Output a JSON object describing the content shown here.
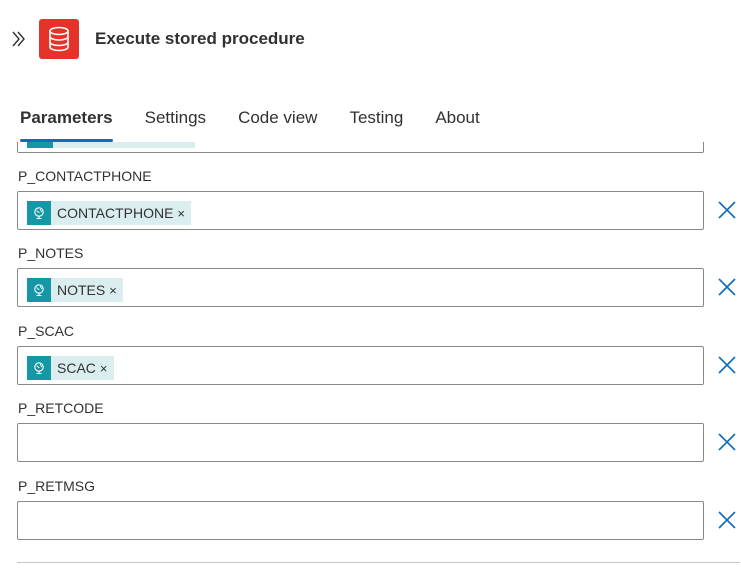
{
  "header": {
    "title": "Execute stored procedure",
    "icon": "database-icon",
    "icon_color": "#e6332a"
  },
  "tabs": [
    {
      "label": "Parameters",
      "active": true
    },
    {
      "label": "Settings",
      "active": false
    },
    {
      "label": "Code view",
      "active": false
    },
    {
      "label": "Testing",
      "active": false
    },
    {
      "label": "About",
      "active": false
    }
  ],
  "fields": [
    {
      "label": "P_CONTACTPHONE",
      "token": "CONTACTPHONE",
      "token_remove": "×"
    },
    {
      "label": "P_NOTES",
      "token": "NOTES",
      "token_remove": "×"
    },
    {
      "label": "P_SCAC",
      "token": "SCAC",
      "token_remove": "×"
    },
    {
      "label": "P_RETCODE",
      "token": null
    },
    {
      "label": "P_RETMSG",
      "token": null
    }
  ],
  "colors": {
    "accent": "#0f6cbd",
    "token_bg": "#dbeeef",
    "token_icon_bg": "#1597a5"
  }
}
